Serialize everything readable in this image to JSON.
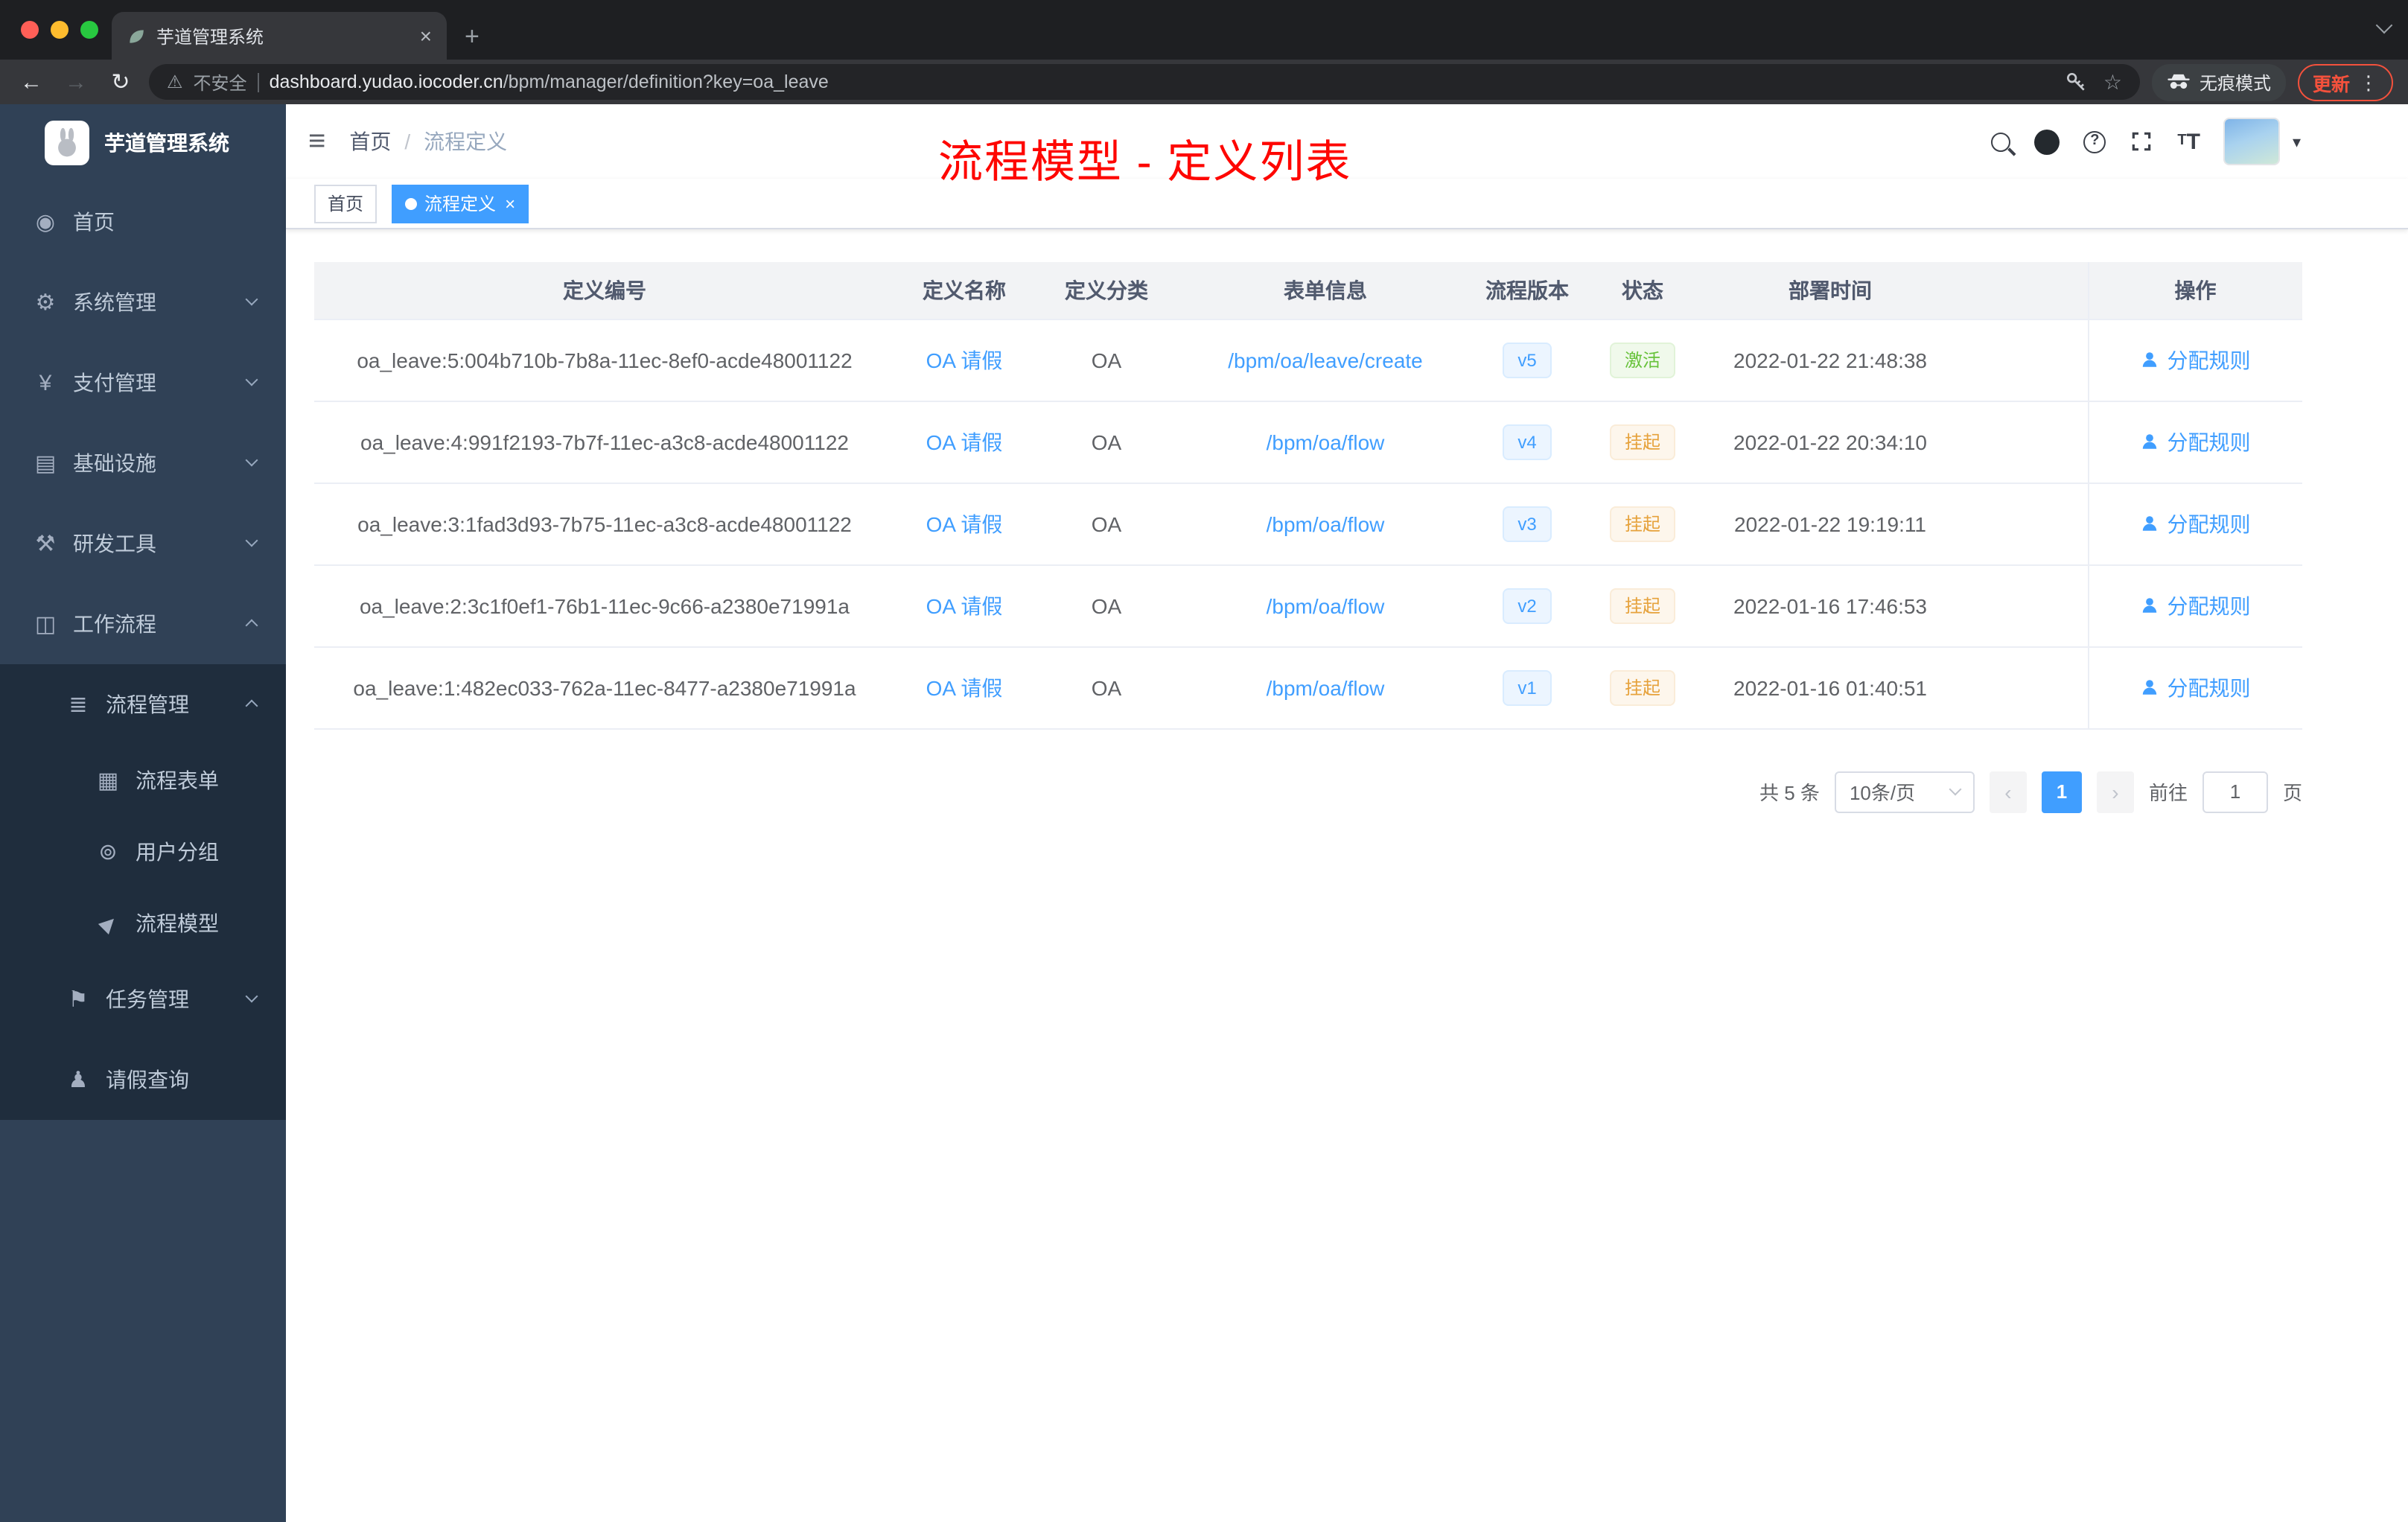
{
  "colors": {
    "accent": "#409eff",
    "success": "#67c23a",
    "warning": "#e6a23c",
    "annotation_red": "#fe0600",
    "sidebar_bg": "#304156",
    "sidebar_sub_bg": "#1f2d3d",
    "traffic_lights": [
      "#ff5f57",
      "#febc2e",
      "#28c840"
    ]
  },
  "browser": {
    "tab_title": "芋道管理系统",
    "close_label": "×",
    "new_tab_label": "+",
    "security_label": "不安全",
    "url_domain": "dashboard.yudao.iocoder.cn",
    "url_path": "/bpm/manager/definition?key=oa_leave",
    "incognito_label": "无痕模式",
    "update_label": "更新"
  },
  "sidebar": {
    "logo_title": "芋道管理系统",
    "items": [
      {
        "label": "首页"
      },
      {
        "label": "系统管理"
      },
      {
        "label": "支付管理"
      },
      {
        "label": "基础设施"
      },
      {
        "label": "研发工具"
      },
      {
        "label": "工作流程"
      },
      {
        "label": "流程管理"
      },
      {
        "label": "流程表单"
      },
      {
        "label": "用户分组"
      },
      {
        "label": "流程模型"
      },
      {
        "label": "任务管理"
      },
      {
        "label": "请假查询"
      }
    ]
  },
  "header": {
    "breadcrumb_home": "首页",
    "breadcrumb_sep": "/",
    "breadcrumb_current": "流程定义",
    "annotation": "流程模型 - 定义列表"
  },
  "tags": {
    "home": "首页",
    "active": "流程定义",
    "close": "×"
  },
  "table": {
    "columns": [
      "定义编号",
      "定义名称",
      "定义分类",
      "表单信息",
      "流程版本",
      "状态",
      "部署时间",
      "操作"
    ],
    "rows": [
      {
        "id": "oa_leave:5:004b710b-7b8a-11ec-8ef0-acde48001122",
        "name": "OA 请假",
        "category": "OA",
        "form": "/bpm/oa/leave/create",
        "version": "v5",
        "status": "激活",
        "time": "2022-01-22 21:48:38",
        "action": "分配规则"
      },
      {
        "id": "oa_leave:4:991f2193-7b7f-11ec-a3c8-acde48001122",
        "name": "OA 请假",
        "category": "OA",
        "form": "/bpm/oa/flow",
        "version": "v4",
        "status": "挂起",
        "time": "2022-01-22 20:34:10",
        "action": "分配规则"
      },
      {
        "id": "oa_leave:3:1fad3d93-7b75-11ec-a3c8-acde48001122",
        "name": "OA 请假",
        "category": "OA",
        "form": "/bpm/oa/flow",
        "version": "v3",
        "status": "挂起",
        "time": "2022-01-22 19:19:11",
        "action": "分配规则"
      },
      {
        "id": "oa_leave:2:3c1f0ef1-76b1-11ec-9c66-a2380e71991a",
        "name": "OA 请假",
        "category": "OA",
        "form": "/bpm/oa/flow",
        "version": "v2",
        "status": "挂起",
        "time": "2022-01-16 17:46:53",
        "action": "分配规则"
      },
      {
        "id": "oa_leave:1:482ec033-762a-11ec-8477-a2380e71991a",
        "name": "OA 请假",
        "category": "OA",
        "form": "/bpm/oa/flow",
        "version": "v1",
        "status": "挂起",
        "time": "2022-01-16 01:40:51",
        "action": "分配规则"
      }
    ]
  },
  "pagination": {
    "total": "共 5 条",
    "page_size": "10条/页",
    "prev": "‹",
    "current": "1",
    "next": "›",
    "goto_label": "前往",
    "goto_value": "1",
    "unit_label": "页"
  },
  "icons": {
    "back": "←",
    "forward": "→",
    "reload": "↻",
    "warning": "⚠",
    "star": "☆",
    "more": "⋮",
    "collapse": "≡",
    "caret": "▾",
    "dashboard": "◉",
    "gear": "⚙",
    "yen": "¥",
    "infrastructure": "▤",
    "tools": "⚒",
    "workflow": "◫",
    "list": "≣",
    "form": "▦",
    "usergroup": "⊚",
    "send": "▶",
    "task": "⚑",
    "person": "♟"
  }
}
